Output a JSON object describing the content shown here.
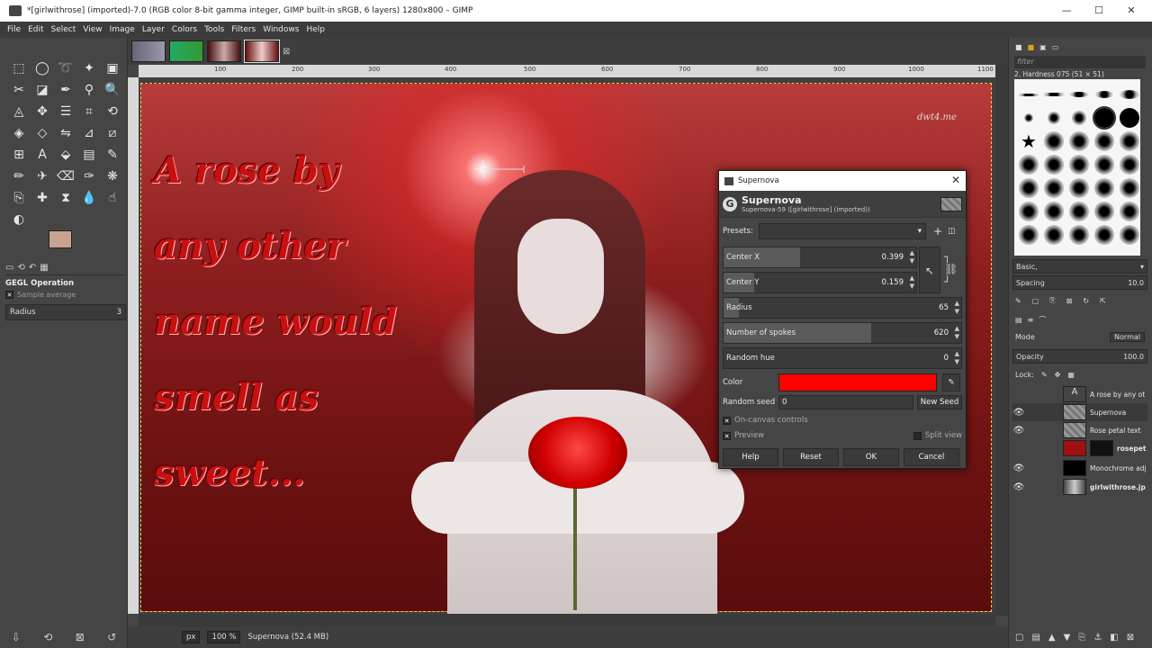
{
  "window": {
    "title": "*[girlwithrose] (imported)-7.0 (RGB color 8-bit gamma integer, GIMP built-in sRGB, 6 layers) 1280x800 – GIMP"
  },
  "menu": [
    "File",
    "Edit",
    "Select",
    "View",
    "Image",
    "Layer",
    "Colors",
    "Tools",
    "Filters",
    "Windows",
    "Help"
  ],
  "tool_options": {
    "title": "GEGL Operation",
    "sample": "Sample average",
    "radius_label": "Radius",
    "radius_value": "3"
  },
  "ruler_marks": [
    "100",
    "200",
    "300",
    "400",
    "500",
    "600",
    "700",
    "800",
    "900",
    "1000",
    "1100"
  ],
  "canvas": {
    "lines": [
      "A rose by",
      "any other",
      "name would",
      "smell as",
      "sweet..."
    ],
    "watermark": "dwt4.me"
  },
  "status": {
    "unit": "px",
    "zoom": "100 %",
    "text": "Supernova (52.4 MB)"
  },
  "brushes": {
    "filter_placeholder": "filter",
    "current": "2. Hardness 075 (51 × 51)",
    "preset": "Basic,",
    "spacing_label": "Spacing",
    "spacing_value": "10.0"
  },
  "layers": {
    "mode_label": "Mode",
    "mode_value": "Normal",
    "opacity_label": "Opacity",
    "opacity_value": "100.0",
    "lock_label": "Lock:",
    "items": [
      {
        "name": "A rose by any ot"
      },
      {
        "name": "Supernova"
      },
      {
        "name": "Rose petal text"
      },
      {
        "name": "rosepet"
      },
      {
        "name": "Monochrome adj"
      },
      {
        "name": "girlwithrose.jp"
      }
    ]
  },
  "dialog": {
    "title": "Supernova",
    "name": "Supernova",
    "subtitle": "Supernova-59 ([girlwithrose] (imported))",
    "presets_label": "Presets:",
    "center_x_label": "Center X",
    "center_x": "0.399",
    "center_x_fill": 0.399,
    "center_y_label": "Center Y",
    "center_y": "0.159",
    "center_y_fill": 0.159,
    "radius_label": "Radius",
    "radius": "65",
    "radius_fill": 0.065,
    "spokes_label": "Number of spokes",
    "spokes": "620",
    "spokes_fill": 0.62,
    "hue_label": "Random hue",
    "hue": "0",
    "color_label": "Color",
    "color_value": "#ff0000",
    "seed_label": "Random seed",
    "seed": "0",
    "new_seed": "New Seed",
    "oncanvas_label": "On-canvas controls",
    "preview_label": "Preview",
    "split_label": "Split view",
    "help": "Help",
    "reset": "Reset",
    "ok": "OK",
    "cancel": "Cancel"
  }
}
